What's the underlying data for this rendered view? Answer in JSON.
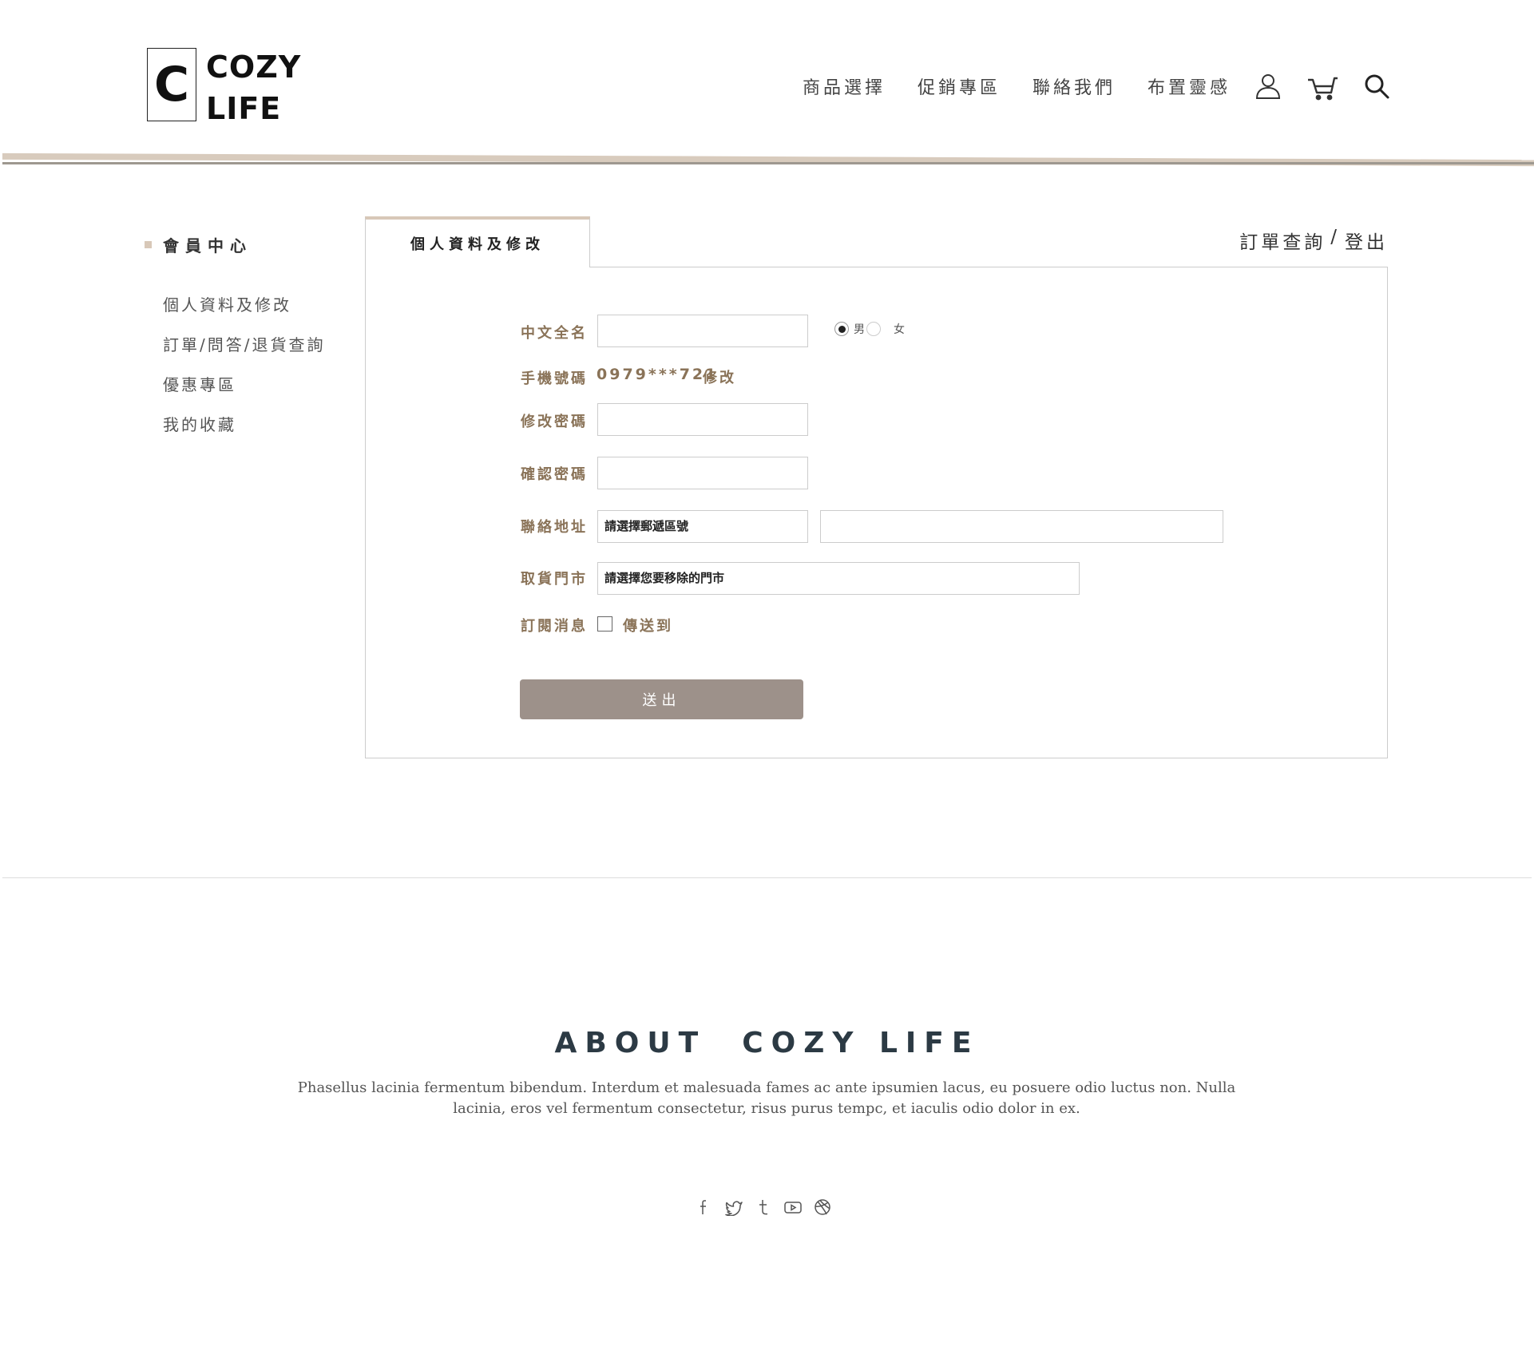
{
  "brand": {
    "logo_letter": "C",
    "logo_line1": "COZY",
    "logo_line2": "LIFE"
  },
  "nav": {
    "links": [
      "商品選擇",
      "促銷專區",
      "聯絡我們",
      "布置靈感"
    ],
    "icons": [
      "user-icon",
      "cart-icon",
      "search-icon"
    ]
  },
  "sidebar": {
    "title": "會員中心",
    "items": [
      "個人資料及修改",
      "訂單/問答/退貨查詢",
      "優惠專區",
      "我的收藏"
    ]
  },
  "panel": {
    "active_tab": "個人資料及修改",
    "top_links": {
      "orders": "訂單查詢",
      "separator": "/",
      "logout": "登出"
    }
  },
  "form": {
    "name_label": "中文全名",
    "name_value": "",
    "gender_options": [
      "男",
      "女"
    ],
    "gender_selected": "男",
    "phone_label": "手機號碼",
    "phone_value": "0979***721",
    "phone_edit": "修改",
    "password_label": "修改密碼",
    "confirm_label": "確認密碼",
    "address_label": "聯絡地址",
    "address_zip": "請選擇郵遞區號",
    "address_detail": "",
    "store_label": "取貨門市",
    "store_value": "請選擇您要移除的門市",
    "subscribe_label": "訂閱消息",
    "subscribe_option": "傳送到",
    "subscribe_checked": false,
    "submit": "送出"
  },
  "footer": {
    "title": "ABOUT  COZY LIFE",
    "text": "Phasellus lacinia fermentum bibendum. Interdum et malesuada fames ac ante ipsumien lacus, eu posuere odio luctus non. Nulla lacinia, eros vel fermentum consectetur, risus purus tempc, et iaculis odio dolor in ex.",
    "social": [
      "facebook-icon",
      "twitter-icon",
      "tumblr-icon",
      "youtube-icon",
      "dribbble-icon"
    ]
  },
  "colors": {
    "accent": "#d8c8b8",
    "label": "#8a7358",
    "button": "#9d918a",
    "footer_title": "#2c3a44"
  }
}
